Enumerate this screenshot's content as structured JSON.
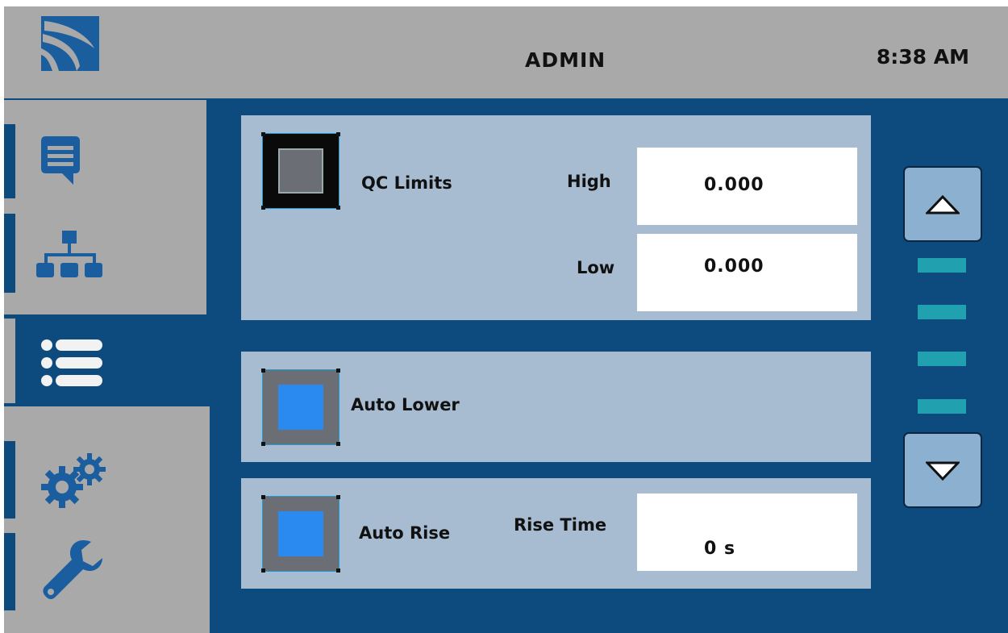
{
  "header": {
    "user": "ADMIN",
    "time": "8:38 AM",
    "logo_icon": "company-logo-icon"
  },
  "sidebar": {
    "items": [
      {
        "id": "messages",
        "icon": "message-icon",
        "active": false
      },
      {
        "id": "network",
        "icon": "network-icon",
        "active": false
      },
      {
        "id": "list",
        "icon": "list-icon",
        "active": true
      },
      {
        "id": "settings",
        "icon": "gears-icon",
        "active": false
      },
      {
        "id": "tools",
        "icon": "wrench-icon",
        "active": false
      }
    ]
  },
  "qc_limits": {
    "label": "QC Limits",
    "checked": false,
    "high_label": "High",
    "high_value": "0.000",
    "low_label": "Low",
    "low_value": "0.000"
  },
  "auto_lower": {
    "label": "Auto Lower",
    "checked": true
  },
  "auto_rise": {
    "label": "Auto Rise",
    "checked": true,
    "rise_time_label": "Rise Time",
    "rise_time_value": "0 s"
  },
  "scroll": {
    "up_icon": "triangle-up-icon",
    "down_icon": "triangle-down-icon",
    "page_indicators": 4
  },
  "colors": {
    "background": "#0d4a7e",
    "panel": "#a7bcd0",
    "chrome": "#a9a9a9",
    "checkbox_on": "#2b8af0",
    "indicator": "#21a0b0"
  }
}
